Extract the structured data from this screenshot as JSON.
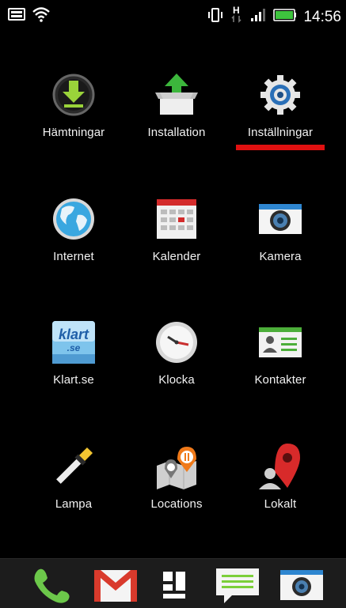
{
  "status_bar": {
    "time": "14:56",
    "icons": [
      "keyboard-icon",
      "wifi-icon",
      "vibrate-icon",
      "hspa-data-icon",
      "signal-icon",
      "battery-icon"
    ]
  },
  "apps": [
    {
      "id": "hamtningar",
      "label": "Hämtningar",
      "icon": "download-icon"
    },
    {
      "id": "installation",
      "label": "Installation",
      "icon": "install-box-icon"
    },
    {
      "id": "installningar",
      "label": "Inställningar",
      "icon": "gear-icon",
      "selected": true
    },
    {
      "id": "internet",
      "label": "Internet",
      "icon": "globe-icon"
    },
    {
      "id": "kalender",
      "label": "Kalender",
      "icon": "calendar-icon"
    },
    {
      "id": "kamera",
      "label": "Kamera",
      "icon": "camera-icon"
    },
    {
      "id": "klart",
      "label": "Klart.se",
      "icon": "klart-logo-icon",
      "logo_text": "klart .se"
    },
    {
      "id": "klocka",
      "label": "Klocka",
      "icon": "clock-icon"
    },
    {
      "id": "kontakter",
      "label": "Kontakter",
      "icon": "contacts-card-icon"
    },
    {
      "id": "lampa",
      "label": "Lampa",
      "icon": "flashlight-icon"
    },
    {
      "id": "locations",
      "label": "Locations",
      "icon": "map-pins-icon"
    },
    {
      "id": "lokalt",
      "label": "Lokalt",
      "icon": "location-pin-person-icon"
    }
  ],
  "dock": [
    {
      "id": "phone",
      "icon": "phone-icon"
    },
    {
      "id": "gmail",
      "icon": "gmail-icon"
    },
    {
      "id": "apps",
      "icon": "app-drawer-icon"
    },
    {
      "id": "messages",
      "icon": "message-icon"
    },
    {
      "id": "camera",
      "icon": "camera-icon"
    }
  ],
  "colors": {
    "background": "#000000",
    "selection_bar": "#e01010",
    "dock_background": "#1c1c1c",
    "battery": "#3ec43e"
  }
}
